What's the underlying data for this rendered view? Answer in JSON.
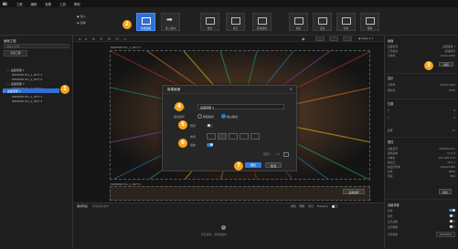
{
  "menubar": {
    "logo": "Hi",
    "items": [
      "工程",
      "编辑",
      "查看",
      "工具",
      "帮助"
    ]
  },
  "toolbar": {
    "left_items": [
      "导入",
      "载体"
    ],
    "groups": [
      {
        "label": "新建画面"
      },
      {
        "label": "插入素材"
      },
      {
        "label": "融合"
      },
      {
        "label": "校正"
      },
      {
        "label": "屏幕编辑"
      },
      {
        "label": "输出"
      },
      {
        "label": "设置"
      },
      {
        "label": "分析"
      },
      {
        "label": "帮助"
      }
    ]
  },
  "left_panel": {
    "title": "画面工程",
    "search_placeholder": "请输入名称",
    "button": "新建工程",
    "tree": [
      {
        "label": "画面容器 1",
        "level": 0
      },
      {
        "label": "MIX3000 Pro_1_OUT 1",
        "level": 1
      },
      {
        "label": "MIX3000 Pro_1_OUT 2",
        "level": 1
      },
      {
        "label": "画面容器 2",
        "level": 0
      },
      {
        "label": "MIX3000 Pro_1_OUT 2",
        "level": 1
      },
      {
        "label": "画面容器 3",
        "level": 0,
        "selected": true
      },
      {
        "label": "MIX3000 Pro_1_OUT 1",
        "level": 1
      },
      {
        "label": "MIX3000 Pro_1_OUT 2",
        "level": 1
      }
    ]
  },
  "canvas": {
    "top_label": "MIX3000 Pro_1_OUT 1",
    "bottom_label": "MIX3000 Pro_1_OUT 2",
    "page_label": "Page 1",
    "corner_button": "设备放置"
  },
  "dialog": {
    "title": "新建画面",
    "name_label": "画面名称",
    "name_value": "画面容器 4",
    "layout_label": "输出模式",
    "radio_options": [
      "拼接模式",
      "独立输出"
    ],
    "preview_label": "预览",
    "grid_label": "布局",
    "scale_label": "缩放",
    "custom_label": "自定义",
    "scale_text": "1:1",
    "ok": "确定",
    "cancel": "取消"
  },
  "bottom_panel": {
    "title": "素材列表",
    "placeholder": "添加媒体素材",
    "right_items": [
      "添加",
      "删除",
      "清空",
      "Mapping"
    ],
    "empty_hint": "暂无素材，请添加素材"
  },
  "right_panel": {
    "sections": [
      {
        "title": "画面",
        "rows": [
          [
            "画面名称",
            "画面容器 3"
          ],
          [
            "工作模式",
            "拼接模式"
          ],
          [
            "分辨率",
            "1920×1080"
          ]
        ],
        "button": "编辑"
      },
      {
        "title": "显示",
        "rows": [
          [
            "分辨率",
            "3840×2160"
          ],
          [
            "刷新率",
            "60Hz"
          ]
        ]
      },
      {
        "title": "位置",
        "rows": [
          [
            "X",
            "0"
          ],
          [
            "Y",
            "0"
          ],
          [
            "旋转",
            "0°"
          ]
        ]
      },
      {
        "title": "属性",
        "rows": [
          [
            "设备型号",
            "MIX3000 Pro"
          ],
          [
            "固件版本",
            "V1.0.0"
          ],
          [
            "IP地址",
            "192.168.0.10"
          ],
          [
            "输出口",
            "OUT 1"
          ],
          [
            "输出分辨率",
            "1920×1080"
          ],
          [
            "帧率",
            "60Hz"
          ],
          [
            "色深",
            "8bit"
          ]
        ],
        "button": "刷新"
      },
      {
        "title": "高级设置",
        "rows": [
          [
            "同步",
            ""
          ],
          [
            "锁定",
            ""
          ],
          [
            "显示边框",
            ""
          ],
          [
            "显示网格",
            ""
          ],
          [
            "背景颜色",
            "#000000"
          ]
        ]
      }
    ]
  },
  "badges": [
    "1",
    "2",
    "3",
    "4",
    "5",
    "6",
    "7"
  ],
  "colors": {
    "accent": "#f4a51c",
    "primary": "#2f7be5",
    "bg": "#1b1b1b"
  }
}
